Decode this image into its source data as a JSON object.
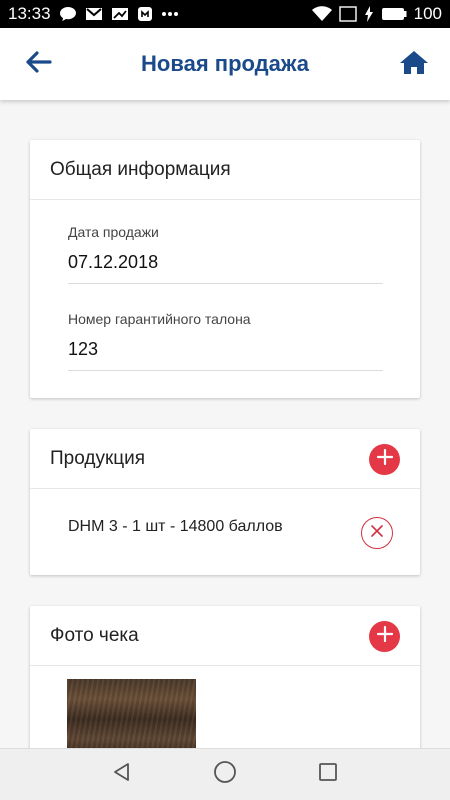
{
  "status_bar": {
    "time": "13:33",
    "battery": "100",
    "icons": [
      "chat-icon",
      "gmail-icon",
      "mail-icon",
      "app-icon",
      "more-dots-icon",
      "wifi-icon",
      "signal-icon",
      "charging-icon",
      "battery-icon"
    ]
  },
  "appbar": {
    "title": "Новая продажа",
    "back_icon": "arrow-left-icon",
    "home_icon": "home-icon"
  },
  "general_info": {
    "header": "Общая информация",
    "sale_date_label": "Дата продажи",
    "sale_date_value": "07.12.2018",
    "warranty_label": "Номер гарантийного талона",
    "warranty_value": "123"
  },
  "products": {
    "header": "Продукция",
    "items": [
      {
        "text": "DHM 3 - 1 шт - 14800 баллов"
      }
    ]
  },
  "receipt_photo": {
    "header": "Фото чека"
  },
  "colors": {
    "primary": "#1b4a8b",
    "accent_red": "#e53846"
  },
  "nav": {
    "back": "back-triangle-icon",
    "home": "home-circle-icon",
    "recents": "recents-square-icon"
  }
}
